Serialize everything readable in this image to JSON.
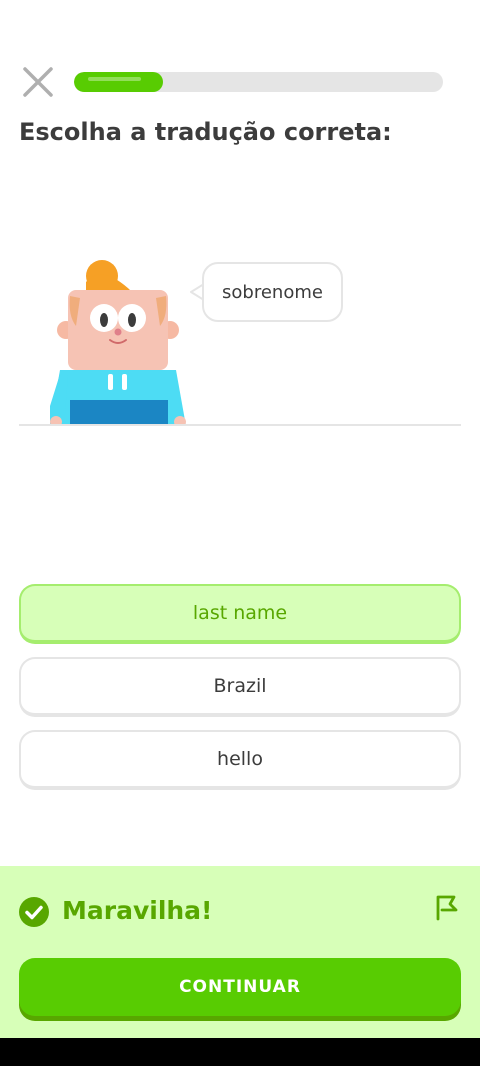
{
  "progress": {
    "fraction": 0.24
  },
  "icons": {
    "close": "close-icon",
    "check": "check-circle-icon",
    "flag": "flag-icon"
  },
  "colors": {
    "accent": "#58cc02",
    "accent_dark": "#58a700",
    "success_bg": "#d7ffb8"
  },
  "prompt": {
    "title": "Escolha a tradução correta:"
  },
  "bubble": {
    "text": "sobrenome"
  },
  "options": [
    {
      "label": "last name",
      "state": "selected"
    },
    {
      "label": "Brazil",
      "state": "default"
    },
    {
      "label": "hello",
      "state": "default"
    }
  ],
  "feedback": {
    "title": "Maravilha!"
  },
  "continue_button": {
    "label": "CONTINUAR"
  }
}
